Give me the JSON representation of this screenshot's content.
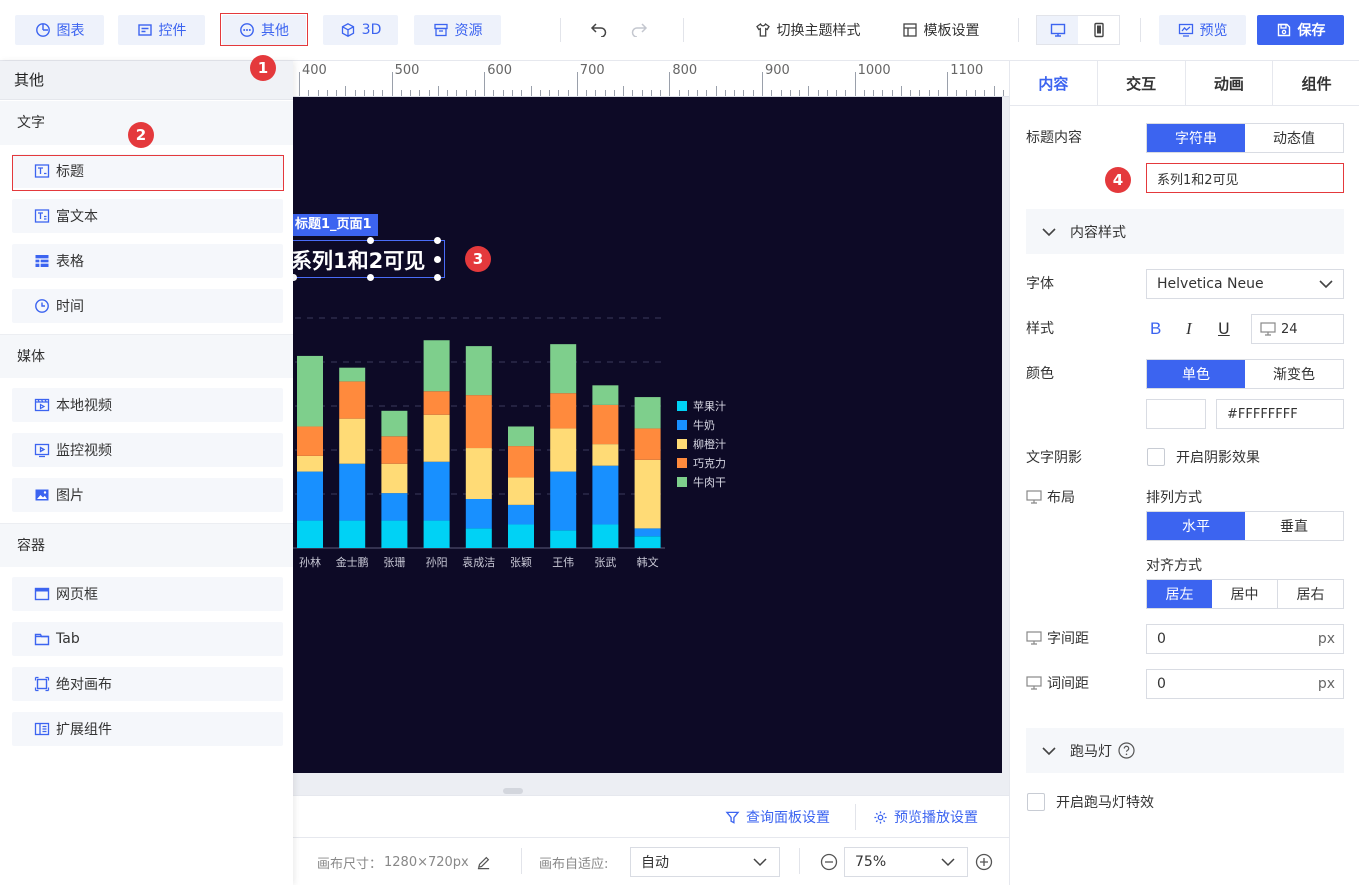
{
  "toolbar": {
    "chart_btn": "图表",
    "control_btn": "控件",
    "other_btn": "其他",
    "threed_btn": "3D",
    "resource_btn": "资源",
    "switch_theme": "切换主题样式",
    "template_settings": "模板设置",
    "preview": "预览",
    "save": "保存"
  },
  "steps": {
    "s1": "1",
    "s2": "2",
    "s3": "3",
    "s4": "4"
  },
  "ruler": {
    "labels": [
      "400",
      "500",
      "600",
      "700",
      "800",
      "900",
      "1000",
      "1100"
    ]
  },
  "left_panel": {
    "title": "其他",
    "sections": [
      {
        "name": "文字",
        "items": [
          "标题",
          "富文本",
          "表格",
          "时间"
        ]
      },
      {
        "name": "媒体",
        "items": [
          "本地视频",
          "监控视频",
          "图片"
        ]
      },
      {
        "name": "容器",
        "items": [
          "网页框",
          "Tab",
          "绝对画布",
          "扩展组件"
        ]
      }
    ]
  },
  "canvas": {
    "selected_tag": "标题1_页面1",
    "title_text": "系列1和2可见"
  },
  "chart_data": {
    "type": "bar",
    "stacked": true,
    "categories": [
      "孙林",
      "金士鹏",
      "张珊",
      "孙阳",
      "袁成洁",
      "张颖",
      "王伟",
      "张武",
      "韩文"
    ],
    "series": [
      {
        "name": "苹果汁",
        "color": "#00d2f5",
        "values": [
          14,
          14,
          14,
          14,
          10,
          12,
          9,
          12,
          6
        ]
      },
      {
        "name": "牛奶",
        "color": "#1890ff",
        "values": [
          25,
          29,
          14,
          30,
          15,
          10,
          30,
          30,
          4
        ]
      },
      {
        "name": "柳橙汁",
        "color": "#ffdb76",
        "values": [
          8,
          23,
          15,
          24,
          26,
          14,
          22,
          11,
          35
        ]
      },
      {
        "name": "巧克力",
        "color": "#ff8a3d",
        "values": [
          15,
          19,
          14,
          12,
          27,
          16,
          18,
          20,
          16
        ]
      },
      {
        "name": "牛肉干",
        "color": "#7ecf8c",
        "values": [
          36,
          7,
          13,
          26,
          25,
          10,
          25,
          10,
          16
        ]
      }
    ],
    "legend_position": "right",
    "grid": "dashed horizontal"
  },
  "bottom": {
    "query_panel": "查询面板设置",
    "preview_play": "预览播放设置",
    "canvas_size_label": "画布尺寸：",
    "canvas_size_value": "1280×720px",
    "adapt_label": "画布自适应:",
    "adapt_value": "自动",
    "zoom_value": "75%"
  },
  "right_panel": {
    "tabs": [
      "内容",
      "交互",
      "动画",
      "组件"
    ],
    "title_content_label": "标题内容",
    "seg_string": "字符串",
    "seg_dynamic": "动态值",
    "title_value": "系列1和2可见",
    "content_style": "内容样式",
    "font_label": "字体",
    "font_value": "Helvetica Neue",
    "style_label": "样式",
    "bold": "B",
    "italic": "I",
    "underline": "U",
    "font_size": "24",
    "color_label": "颜色",
    "seg_solid": "单色",
    "seg_gradient": "渐变色",
    "color_hex": "#FFFFFFFF",
    "shadow_label": "文字阴影",
    "shadow_check": "开启阴影效果",
    "layout_label": "布局",
    "arrange_label": "排列方式",
    "seg_horizontal": "水平",
    "seg_vertical": "垂直",
    "align_label": "对齐方式",
    "seg_left": "居左",
    "seg_center": "居中",
    "seg_right": "居右",
    "letter_spacing_label": "字间距",
    "letter_spacing_value": "0",
    "word_spacing_label": "词间距",
    "word_spacing_value": "0",
    "px": "px",
    "marquee": "跑马灯",
    "marquee_check": "开启跑马灯特效"
  },
  "colors": {
    "accent": "#3c64f0",
    "marker": "#e4393c",
    "canvas_bg": "#0d0a26"
  }
}
